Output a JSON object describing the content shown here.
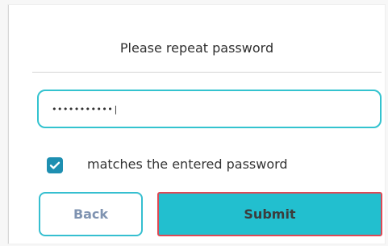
{
  "dialog": {
    "title": "Please repeat password",
    "password_value": "•••••••••••|",
    "checkbox_label": "matches the entered password",
    "checkbox_checked": true,
    "back_label": "Back",
    "submit_label": "Submit"
  },
  "colors": {
    "accent": "#22BFCF",
    "checkbox": "#1E8FB1",
    "submit_border": "#DD4A56",
    "back_text": "#7F93B1"
  },
  "icons": {
    "checkbox": "check-icon"
  }
}
